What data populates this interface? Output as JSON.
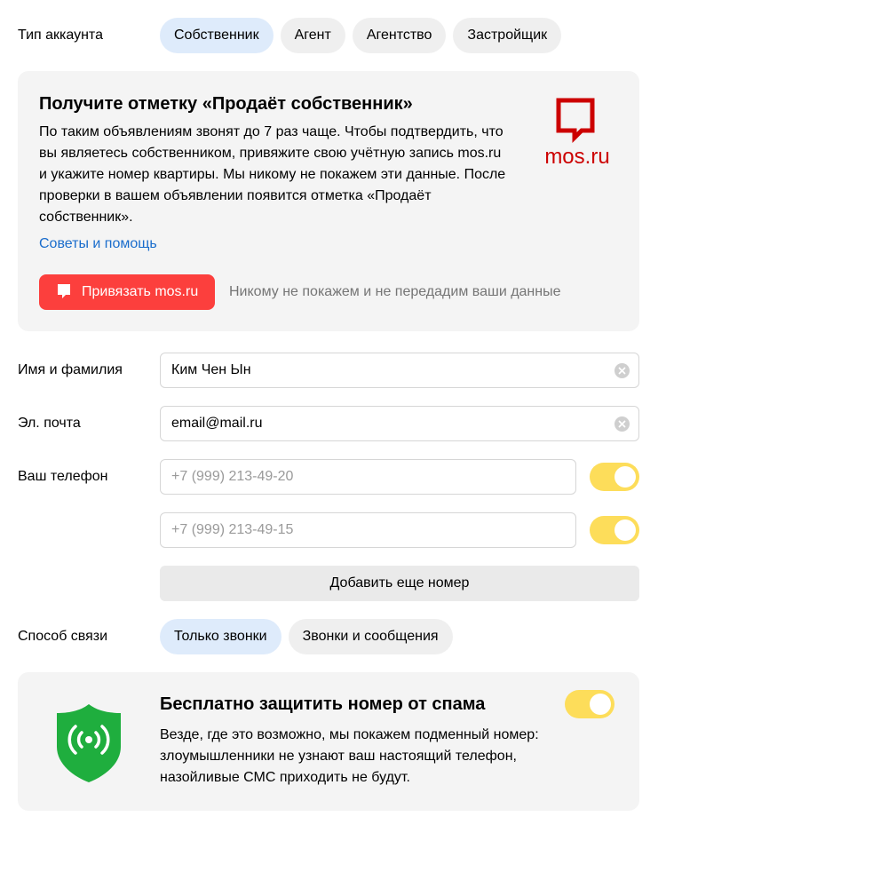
{
  "account_type": {
    "label": "Тип аккаунта",
    "options": [
      {
        "label": "Собственник",
        "selected": true
      },
      {
        "label": "Агент",
        "selected": false
      },
      {
        "label": "Агентство",
        "selected": false
      },
      {
        "label": "Застройщик",
        "selected": false
      }
    ]
  },
  "mos_card": {
    "title": "Получите отметку «Продаёт собственник»",
    "text": "По таким объявлениям звонят до 7 раз чаще. Чтобы подтвердить, что вы являетесь собственником, привяжите свою учётную запись mos.ru и укажите номер квартиры. Мы никому не покажем эти данные. После проверки в вашем объявлении появится отметка «Продаёт собственник».",
    "help_link": "Советы и помощь",
    "logo_text": "mos.ru",
    "button_label": "Привязать mos.ru",
    "note": "Никому не покажем и не передадим ваши данные",
    "brand_color": "#cc0000",
    "button_color": "#fc3f3d",
    "icon": "mos-ru-logo-icon"
  },
  "name_field": {
    "label": "Имя и фамилия",
    "value": "Ким Чен Ын"
  },
  "email_field": {
    "label": "Эл. почта",
    "value": "email@mail.ru"
  },
  "phone": {
    "label": "Ваш телефон",
    "numbers": [
      {
        "placeholder": "+7 (999) 213-49-20",
        "enabled": true
      },
      {
        "placeholder": "+7 (999) 213-49-15",
        "enabled": true
      }
    ],
    "add_button": "Добавить еще номер"
  },
  "contact_method": {
    "label": "Способ связи",
    "options": [
      {
        "label": "Только звонки",
        "selected": true
      },
      {
        "label": "Звонки и сообщения",
        "selected": false
      }
    ]
  },
  "spam_card": {
    "title": "Бесплатно защитить номер от спама",
    "text": "Везде, где это возможно, мы покажем подменный номер: злоумышленники не узнают ваш настоящий телефон, назойливые СМС приходить не будут.",
    "enabled": true,
    "icon": "shield-signal-icon",
    "shield_color": "#1fae3e"
  },
  "colors": {
    "toggle_on": "#fddd5a",
    "pill_selected": "#deebfb",
    "pill_default": "#efefef",
    "link": "#1a6dcc"
  }
}
